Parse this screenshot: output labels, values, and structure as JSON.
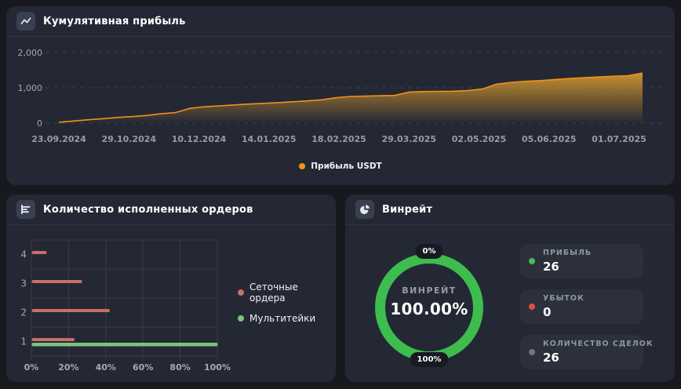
{
  "panels": {
    "cumulative": {
      "title": "Кумулятивная прибыль",
      "legend": [
        {
          "label": "Прибыль USDT",
          "color": "#f0921e"
        }
      ]
    },
    "orders": {
      "title": "Количество исполненных ордеров",
      "legend": [
        {
          "label": "Сеточные ордера",
          "color": "#ca6e69"
        },
        {
          "label": "Мультитейки",
          "color": "#7cc47f"
        }
      ]
    },
    "winrate": {
      "title": "Винрейт",
      "gauge": {
        "center_label": "ВИНРЕЙТ",
        "center_value": "100.00%",
        "top_badge": "0%",
        "bottom_badge": "100%",
        "ring_color": "#3dbd4e"
      },
      "stats": [
        {
          "label": "ПРИБЫЛЬ",
          "value": "26",
          "dot_color": "#4cb85c"
        },
        {
          "label": "УБЫТОК",
          "value": "0",
          "dot_color": "#db4f44"
        },
        {
          "label": "КОЛИЧЕСТВО СДЕЛОК",
          "value": "26",
          "dot_color": "#71757f"
        }
      ]
    }
  },
  "chart_data": [
    {
      "type": "area",
      "title": "Кумулятивная прибыль",
      "xlabel": "",
      "ylabel": "",
      "x_ticks": [
        "23.09.2024",
        "29.10.2024",
        "10.12.2024",
        "14.01.2025",
        "18.02.2025",
        "29.03.2025",
        "02.05.2025",
        "05.06.2025",
        "01.07.2025"
      ],
      "y_ticks": [
        0,
        1000,
        2000
      ],
      "y_tick_labels": [
        "0",
        "1,000",
        "2,000"
      ],
      "ylim": [
        0,
        2200
      ],
      "grid": "horizontal-dashed",
      "legend_position": "bottom-center",
      "series": [
        {
          "name": "Прибыль USDT",
          "color": "#f0921e",
          "fill": "#d69a2e",
          "values": [
            25,
            60,
            95,
            125,
            160,
            185,
            215,
            265,
            300,
            420,
            465,
            490,
            515,
            540,
            560,
            580,
            605,
            630,
            660,
            720,
            755,
            765,
            775,
            785,
            880,
            895,
            900,
            905,
            920,
            965,
            1105,
            1155,
            1185,
            1205,
            1235,
            1265,
            1290,
            1310,
            1330,
            1345,
            1420
          ]
        }
      ]
    },
    {
      "type": "bar",
      "orientation": "horizontal",
      "title": "Количество исполненных ордеров",
      "categories": [
        "4",
        "3",
        "2",
        "1"
      ],
      "x_ticks": [
        "0%",
        "20%",
        "40%",
        "60%",
        "80%",
        "100%"
      ],
      "xlim": [
        0,
        100
      ],
      "grid": "on",
      "legend_position": "right",
      "series": [
        {
          "name": "Сеточные ордера",
          "color": "#ca6e69",
          "values": [
            8,
            27,
            42,
            23
          ]
        },
        {
          "name": "Мультитейки",
          "color": "#7cc47f",
          "values": [
            null,
            null,
            null,
            100
          ]
        }
      ]
    },
    {
      "type": "donut",
      "title": "Винрейт",
      "label": "ВИНРЕЙТ",
      "value": 100.0,
      "value_display": "100.00%",
      "min_label": "0%",
      "max_label": "100%",
      "color": "#3dbd4e"
    }
  ]
}
